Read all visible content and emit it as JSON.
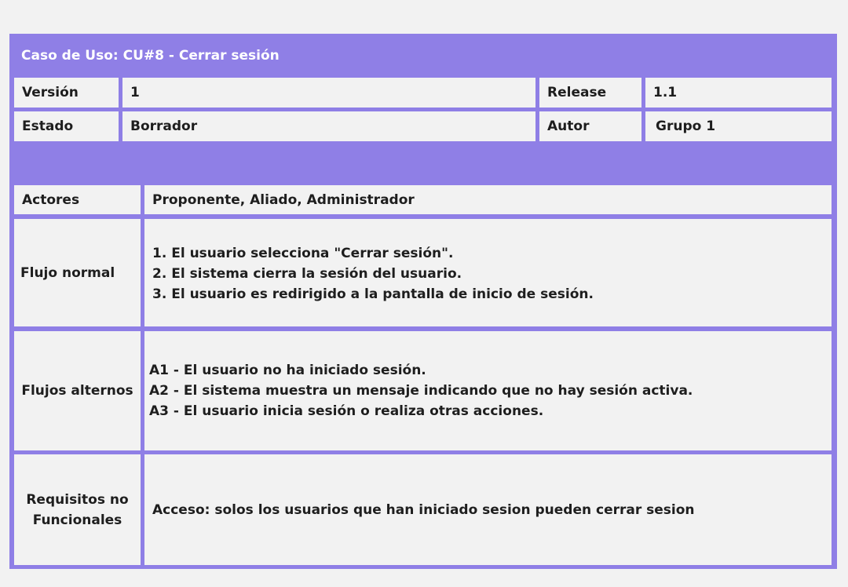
{
  "header": {
    "title": "Caso de Uso: CU#8 - Cerrar sesión"
  },
  "meta": {
    "version_label": "Versión",
    "version_value": "1",
    "release_label": "Release",
    "release_value": "1.1",
    "state_label": "Estado",
    "state_value": "Borrador",
    "author_label": "Autor",
    "author_value": "Grupo 1"
  },
  "actors": {
    "label": "Actores",
    "value": "Proponente, Aliado, Administrador"
  },
  "normal_flow": {
    "label": "Flujo normal",
    "steps": [
      "1. El usuario selecciona \"Cerrar sesión\".",
      "2. El sistema cierra la sesión del usuario.",
      "3. El usuario es redirigido a la pantalla de inicio de sesión."
    ]
  },
  "alternate_flows": {
    "label": "Flujos alternos",
    "steps": [
      "A1 - El usuario no ha iniciado sesión.",
      "A2 - El sistema muestra un mensaje indicando que no hay sesión activa.",
      "A3 - El usuario inicia sesión o realiza otras acciones."
    ]
  },
  "non_functional": {
    "label_line1": "Requisitos no",
    "label_line2": "Funcionales",
    "value": "Acceso: solos los usuarios que han iniciado sesion pueden cerrar sesion"
  }
}
